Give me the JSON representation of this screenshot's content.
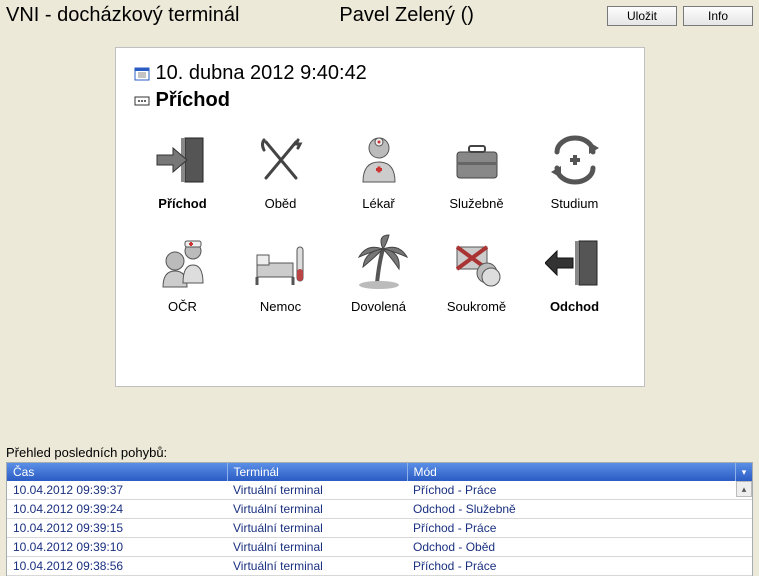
{
  "header": {
    "title": "VNI - docházkový terminál",
    "user": "Pavel Zelený ()",
    "save": "Uložit",
    "info": "Info"
  },
  "panel": {
    "datetime": "10. dubna 2012 9:40:42",
    "mode": "Příchod"
  },
  "tiles": [
    {
      "label": "Příchod",
      "bold": true
    },
    {
      "label": "Oběd",
      "bold": false
    },
    {
      "label": "Lékař",
      "bold": false
    },
    {
      "label": "Služebně",
      "bold": false
    },
    {
      "label": "Studium",
      "bold": false
    },
    {
      "label": "OČR",
      "bold": false
    },
    {
      "label": "Nemoc",
      "bold": false
    },
    {
      "label": "Dovolená",
      "bold": false
    },
    {
      "label": "Soukromě",
      "bold": false
    },
    {
      "label": "Odchod",
      "bold": true
    }
  ],
  "table": {
    "title": "Přehled posledních pohybů:",
    "cols": [
      "Čas",
      "Terminál",
      "Mód"
    ],
    "rows": [
      [
        "10.04.2012 09:39:37",
        "Virtuální terminal",
        "Příchod - Práce"
      ],
      [
        "10.04.2012 09:39:24",
        "Virtuální terminal",
        "Odchod - Služebně"
      ],
      [
        "10.04.2012 09:39:15",
        "Virtuální terminal",
        "Příchod - Práce"
      ],
      [
        "10.04.2012 09:39:10",
        "Virtuální terminal",
        "Odchod - Oběd"
      ],
      [
        "10.04.2012 09:38:56",
        "Virtuální terminal",
        "Příchod - Práce"
      ]
    ]
  }
}
